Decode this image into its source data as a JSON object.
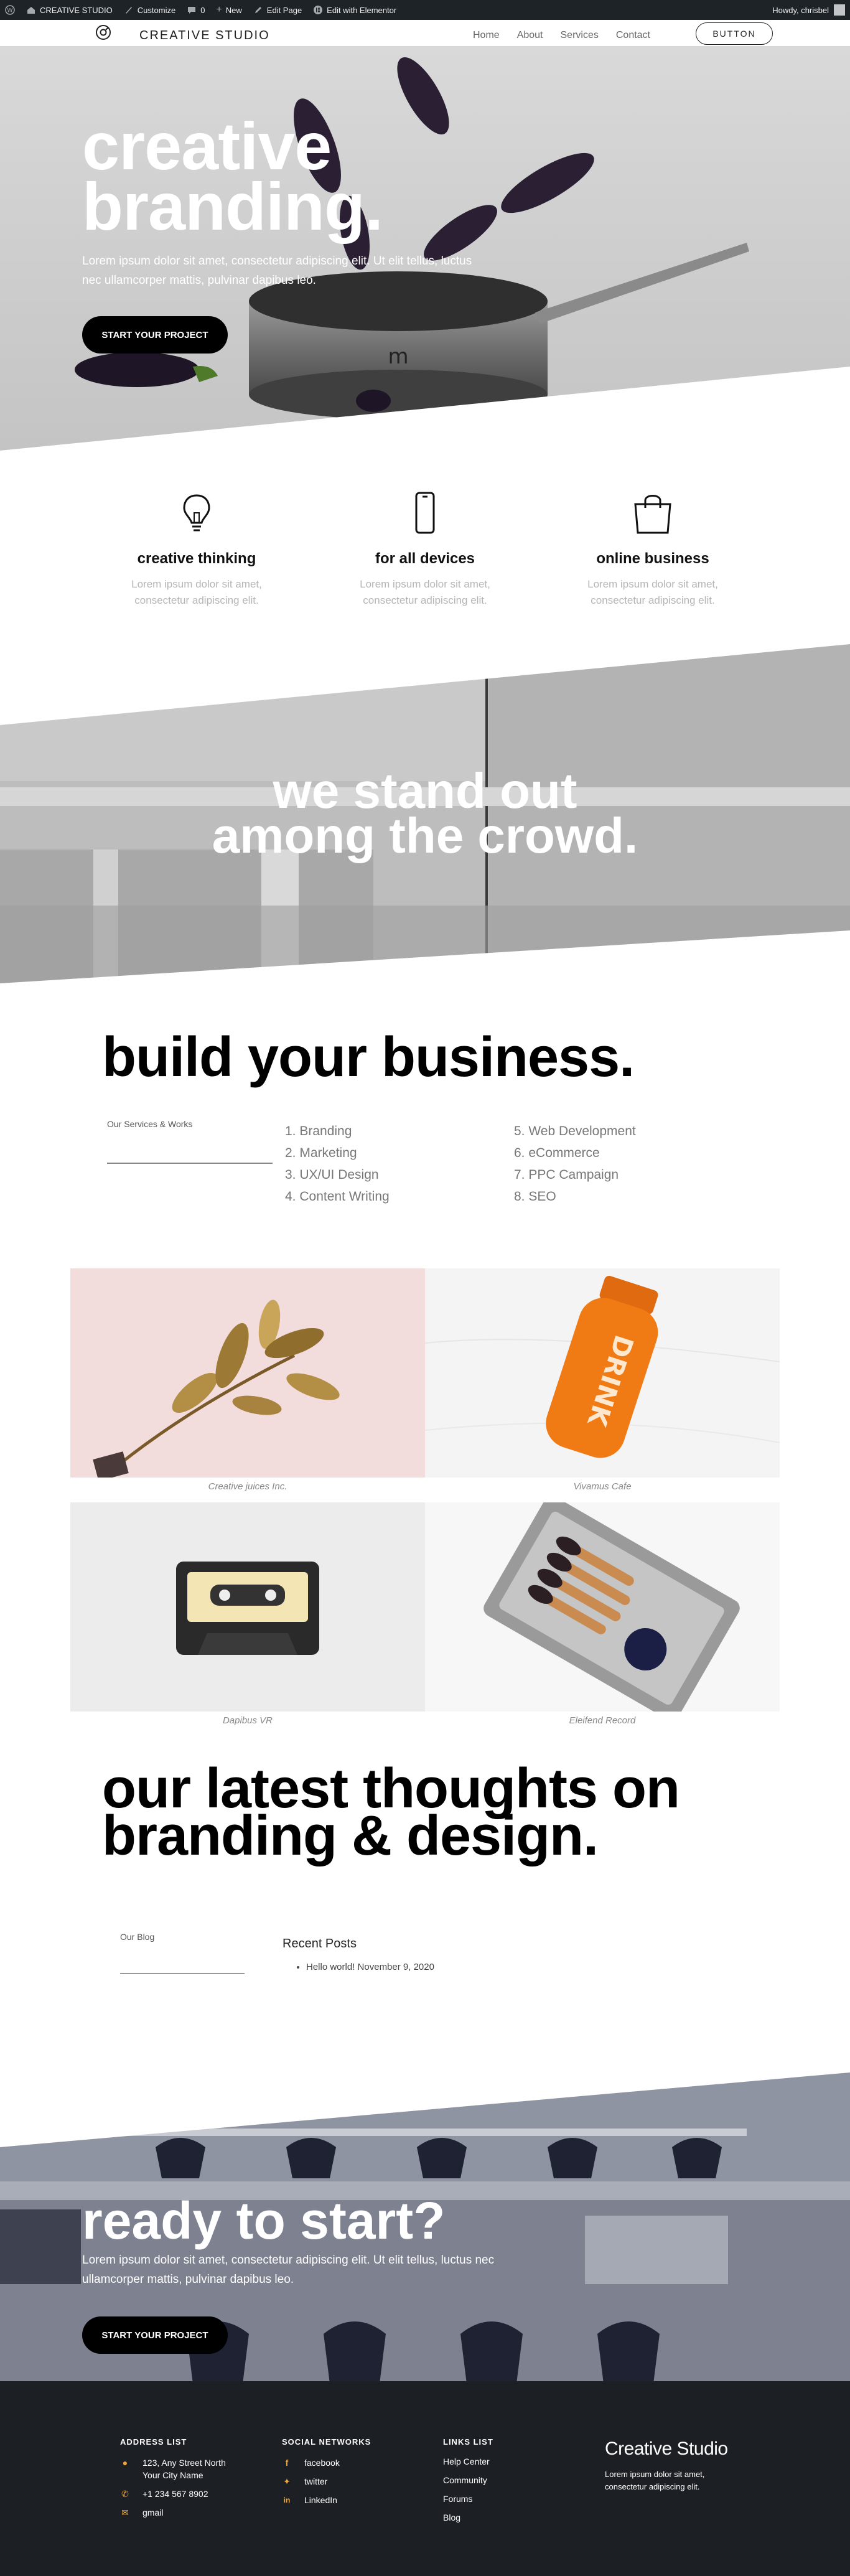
{
  "adminbar": {
    "site_name": "CREATIVE STUDIO",
    "customize": "Customize",
    "comments_count": "0",
    "new": "New",
    "edit_page": "Edit Page",
    "edit_elementor": "Edit with Elementor",
    "howdy": "Howdy, chrisbel"
  },
  "header": {
    "logo_text": "CREATIVE STUDIO",
    "nav": [
      "Home",
      "About",
      "Services",
      "Contact"
    ],
    "button": "BUTTON"
  },
  "hero": {
    "title_line1": "creative",
    "title_line2": "branding.",
    "body": "Lorem ipsum dolor sit amet, consectetur adipiscing elit. Ut elit tellus, luctus nec ullamcorper mattis, pulvinar dapibus leo.",
    "cta": "START YOUR PROJECT"
  },
  "features": [
    {
      "title": "creative thinking",
      "desc": "Lorem ipsum dolor sit amet, consectetur adipiscing elit.",
      "icon": "lightbulb-icon"
    },
    {
      "title": "for all devices",
      "desc": "Lorem ipsum dolor sit amet, consectetur adipiscing elit.",
      "icon": "phone-icon"
    },
    {
      "title": "online business",
      "desc": "Lorem ipsum dolor sit amet, consectetur adipiscing elit.",
      "icon": "shopping-bag-icon"
    }
  ],
  "standout": {
    "line1": "we stand out",
    "line2": "among the crowd."
  },
  "build": {
    "title": "build your business.",
    "label": "Our Services & Works",
    "services_left": [
      "1. Branding",
      "2. Marketing",
      "3. UX/UI Design",
      "4. Content Writing"
    ],
    "services_right": [
      "5. Web Development",
      "6. eCommerce",
      "7. PPC Campaign",
      "8. SEO"
    ]
  },
  "portfolio": [
    {
      "caption": "Creative juices Inc."
    },
    {
      "caption": "Vivamus Cafe"
    },
    {
      "caption": "Dapibus VR"
    },
    {
      "caption": "Eleifend Record"
    }
  ],
  "thoughts": {
    "line1": "our latest thoughts on",
    "line2": "branding & design.",
    "blog_label": "Our Blog",
    "recent_title": "Recent Posts",
    "recent_post": "Hello world!",
    "recent_date": "November 9, 2020"
  },
  "cta": {
    "title": "ready to start?",
    "body": "Lorem ipsum dolor sit amet, consectetur adipiscing elit. Ut elit tellus, luctus nec ullamcorper mattis, pulvinar dapibus leo.",
    "button": "START YOUR PROJECT"
  },
  "footer": {
    "address_heading": "ADDRESS LIST",
    "address_line1": "123, Any Street North",
    "address_line2": "Your City Name",
    "phone": "+1 234 567 8902",
    "email": "gmail",
    "social_heading": "SOCIAL NETWORKS",
    "social": [
      "facebook",
      "twitter",
      "LinkedIn"
    ],
    "links_heading": "LINKS LIST",
    "links": [
      "Help Center",
      "Community",
      "Forums",
      "Blog"
    ],
    "brand": "Creative Studio",
    "brand_desc": "Lorem ipsum dolor sit amet, consectetur adipiscing elit."
  },
  "colors": {
    "accent_orange": "#f2a640",
    "footer_bg": "#1c1f23",
    "adminbar_bg": "#1d2327"
  }
}
